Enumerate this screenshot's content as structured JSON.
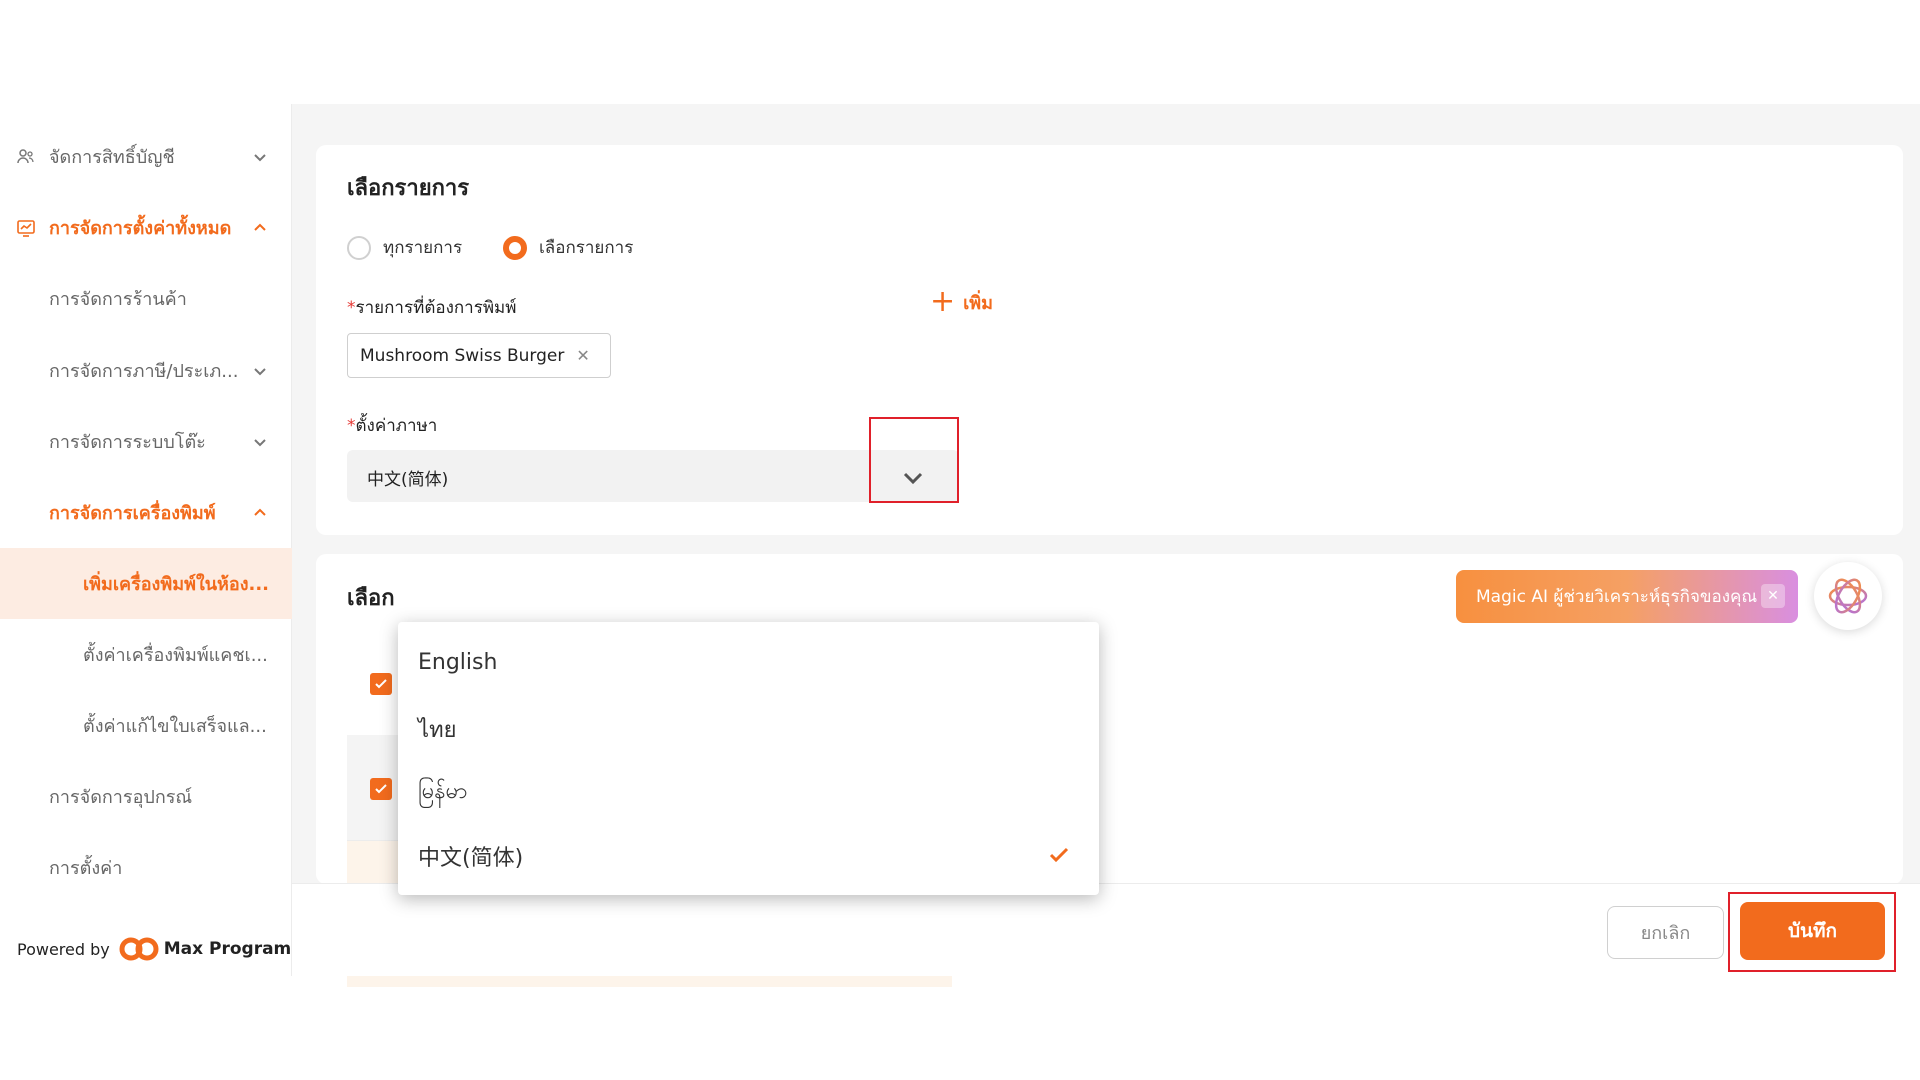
{
  "sidebar": {
    "items": [
      {
        "label": "จัดการสิทธิ์บัญชี",
        "icon": "user-group-icon",
        "chevron": "down"
      },
      {
        "label": "การจัดการตั้งค่าทั้งหมด",
        "icon": "settings-chart-icon",
        "chevron": "up"
      },
      {
        "label": "การจัดการร้านค้า"
      },
      {
        "label": "การจัดการภาษี/ประเภ...",
        "chevron": "down"
      },
      {
        "label": "การจัดการระบบโต๊ะ",
        "chevron": "down"
      },
      {
        "label": "การจัดการเครื่องพิมพ์",
        "chevron": "up"
      },
      {
        "label": "เพิ่มเครื่องพิมพ์ในห้อง..."
      },
      {
        "label": "ตั้งค่าเครื่องพิมพ์แคชเ..."
      },
      {
        "label": "ตั้งค่าแก้ไขใบเสร็จแล..."
      },
      {
        "label": "การจัดการอุปกรณ์"
      },
      {
        "label": "การตั้งค่า"
      }
    ],
    "powered_by": "Powered by",
    "brand": "Max Program"
  },
  "main": {
    "section1_title": "เลือกรายการ",
    "radio_all": "ทุกรายการ",
    "radio_select": "เลือกรายการ",
    "print_items_label": "รายการที่ต้องการพิมพ์",
    "required_mark": "*",
    "add_label": "เพิ่ม",
    "selected_tag": "Mushroom Swiss Burger",
    "tag_remove": "✕",
    "language_label": "ตั้งค่าภาษา",
    "language_value": "中文(简体)",
    "section2_title_partial": "เลือก"
  },
  "dropdown": {
    "options": [
      "English",
      "ไทย",
      "မြန်မာ",
      "中文(简体)"
    ],
    "selected_index": 3
  },
  "magic_ai": {
    "label": "Magic AI ผู้ช่วยวิเคราะห์ธุรกิจของคุณ",
    "close": "✕"
  },
  "footer": {
    "cancel": "ยกเลิก",
    "save": "บันทึก"
  },
  "colors": {
    "accent": "#f26b1d",
    "highlight_box": "#e0202a",
    "active_bg": "#fdece2"
  }
}
